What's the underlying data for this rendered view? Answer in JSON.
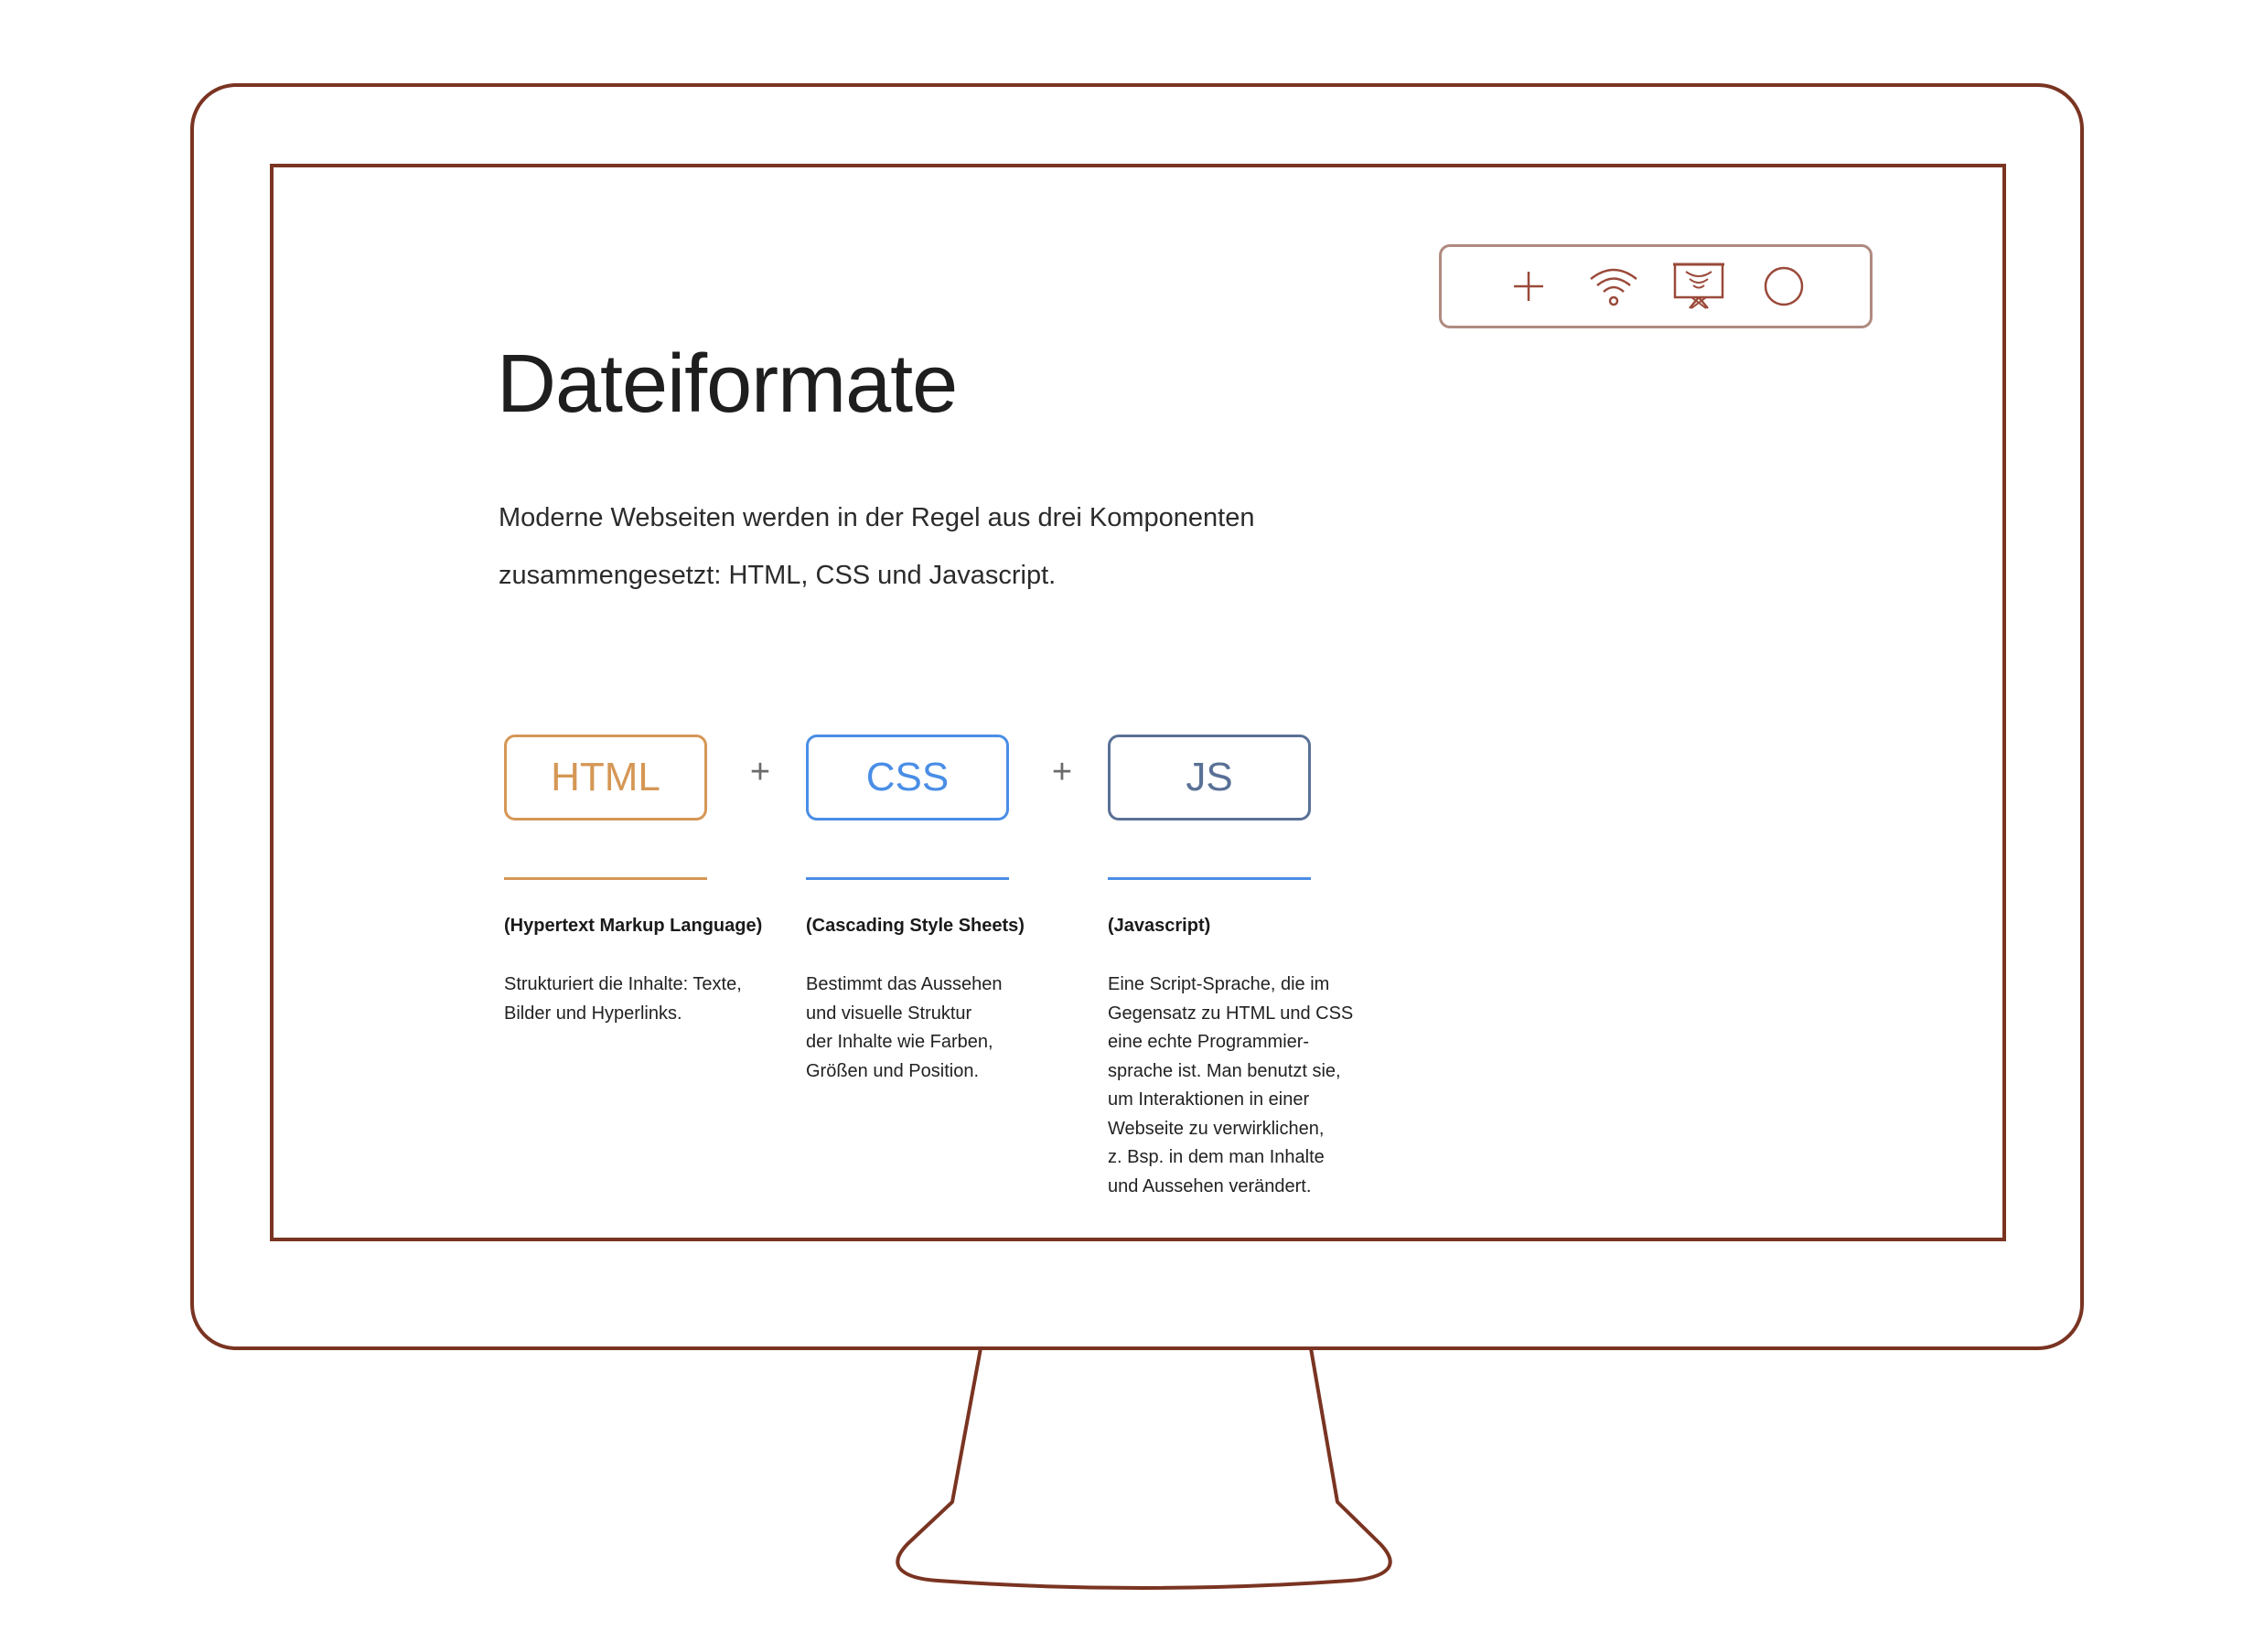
{
  "colors": {
    "monitor_outline": "#7a3422",
    "toolbar_outline": "#b08a80",
    "html_accent": "#d59755",
    "css_accent": "#4a8ee6",
    "js_accent": "#5a7196"
  },
  "toolbar": {
    "icons": [
      "plus-icon",
      "wifi-icon",
      "presentation-icon",
      "circle-icon"
    ]
  },
  "page": {
    "title": "Dateiformate",
    "intro": "Moderne Webseiten werden in der Regel aus drei Komponenten zusammengesetzt: HTML, CSS und Javascript."
  },
  "formats": [
    {
      "label": "HTML",
      "full_name": "(Hypertext Markup Language)",
      "description": "Strukturiert die Inhalte: Texte,\nBilder und Hyperlinks."
    },
    {
      "label": "CSS",
      "full_name": "(Cascading Style Sheets)",
      "description": "Bestimmt das Aussehen\nund visuelle Struktur\nder Inhalte wie Farben,\nGrößen und Position."
    },
    {
      "label": "JS",
      "full_name": "(Javascript)",
      "description": "Eine Script-Sprache, die im\nGegensatz zu HTML und CSS\neine echte Programmier-\nsprache ist. Man benutzt sie,\num Interaktionen in einer\nWebseite zu verwirklichen,\nz. Bsp. in dem man Inhalte\nund Aussehen verändert."
    }
  ],
  "operators": {
    "plus": "+"
  }
}
